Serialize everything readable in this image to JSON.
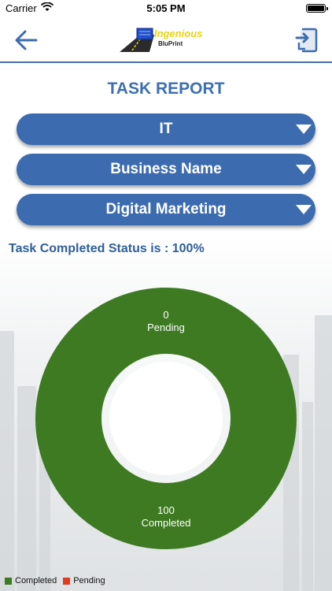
{
  "status_bar": {
    "carrier": "Carrier",
    "time": "5:05 PM"
  },
  "header": {
    "logo_title": "Ingenious",
    "logo_subtitle": "BluPrint",
    "back_icon": "arrow-left-icon",
    "export_icon": "export-icon"
  },
  "page_title": "TASK REPORT",
  "filters": {
    "department": "IT",
    "business": "Business Name",
    "service": "Digital Marketing"
  },
  "summary": "Task Completed Status is : 100%",
  "chart_data": {
    "type": "pie",
    "categories": [
      "Completed",
      "Pending"
    ],
    "values": [
      100,
      0
    ],
    "colors": [
      "#3d7a22",
      "#e43b1f"
    ],
    "style": "donut"
  },
  "labels": {
    "pending_value": "0",
    "pending_label": "Pending",
    "completed_value": "100",
    "completed_label": "Completed"
  },
  "legend": {
    "completed": "Completed",
    "pending": "Pending"
  },
  "colors": {
    "primary": "#3c6bb0",
    "completed": "#3d7a22",
    "pending": "#e43b1f"
  }
}
